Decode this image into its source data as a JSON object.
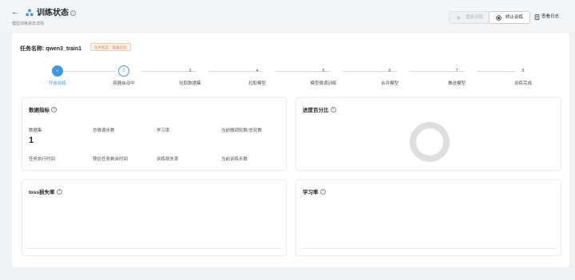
{
  "header": {
    "back_icon": "arrow-left-icon",
    "logo_icon": "tri-dot-logo-icon",
    "title": "训练状态",
    "subtitle": "模型训练状态详情",
    "accent": "#3a9ae8",
    "buttons": {
      "resume": "重新训练",
      "stop": "终止训练",
      "log": "查看日志"
    }
  },
  "task": {
    "label": "任务名称:",
    "name": "qwen3_train1",
    "status_badge": "任务状态：容器启动"
  },
  "steps": [
    {
      "number": "✓",
      "label": "开始训练",
      "state": "done"
    },
    {
      "number": "2",
      "label": "容器启动中",
      "state": "active"
    },
    {
      "number": "3",
      "label": "拉取数据集",
      "state": "pending"
    },
    {
      "number": "4",
      "label": "拉取模型",
      "state": "pending"
    },
    {
      "number": "5",
      "label": "模型微调训练",
      "state": "pending"
    },
    {
      "number": "6",
      "label": "合并模型",
      "state": "pending"
    },
    {
      "number": "7",
      "label": "推送模型",
      "state": "pending"
    },
    {
      "number": "8",
      "label": "训练完成",
      "state": "pending"
    }
  ],
  "metrics": {
    "title": "数据指标",
    "items": [
      {
        "label": "数据集",
        "value": "1"
      },
      {
        "label": "总微调步数",
        "value": ""
      },
      {
        "label": "学习率",
        "value": ""
      },
      {
        "label": "当前微调轮数/总轮数",
        "value": ""
      },
      {
        "label": "任务执行时间",
        "value": ""
      },
      {
        "label": "预估任务剩余时间",
        "value": ""
      },
      {
        "label": "训练损失率",
        "value": ""
      },
      {
        "label": "当前训练步数",
        "value": ""
      }
    ]
  },
  "progress": {
    "title": "进度百分比"
  },
  "loss_chart": {
    "title": "loss损失率"
  },
  "lr_chart": {
    "title": "学习率"
  }
}
